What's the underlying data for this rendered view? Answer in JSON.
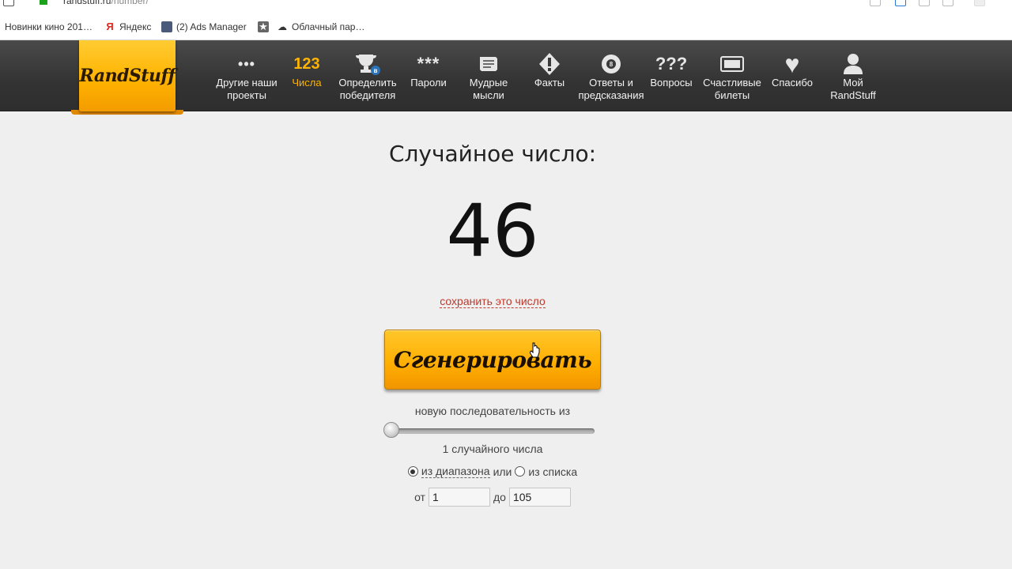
{
  "browser": {
    "url_host": "randstuff.ru",
    "url_path": "/number/",
    "bookmarks": [
      {
        "label": "Новинки кино 201…",
        "icon": "text-only"
      },
      {
        "label": "Яндекс",
        "icon": "yandex-icon"
      },
      {
        "label": "(2) Ads Manager",
        "icon": "ads-manager-icon"
      },
      {
        "label": "",
        "icon": "star-icon"
      },
      {
        "label": "Облачный пар…",
        "icon": "cloud-icon"
      }
    ]
  },
  "site": {
    "logo": "RandStuff",
    "nav": [
      {
        "icon": "dots-icon",
        "glyph": "•••",
        "label": "Другие наши проекты"
      },
      {
        "icon": "numbers-icon",
        "glyph": "123",
        "label": "Числа",
        "active": true
      },
      {
        "icon": "trophy-icon",
        "glyph": "🏆",
        "label": "Определить победителя"
      },
      {
        "icon": "password-icon",
        "glyph": "***",
        "label": "Пароли"
      },
      {
        "icon": "scroll-icon",
        "glyph": "📜",
        "label": "Мудрые мысли"
      },
      {
        "icon": "exclamation-icon",
        "glyph": "!",
        "label": "Факты"
      },
      {
        "icon": "eight-ball-icon",
        "glyph": "8",
        "label": "Ответы и предсказания"
      },
      {
        "icon": "questions-icon",
        "glyph": "???",
        "label": "Вопросы"
      },
      {
        "icon": "ticket-icon",
        "glyph": "▭",
        "label": "Счастливые билеты"
      },
      {
        "icon": "heart-icon",
        "glyph": "♥",
        "label": "Спасибо"
      },
      {
        "icon": "user-icon",
        "glyph": "👤",
        "label": "Мой RandStuff"
      }
    ]
  },
  "main": {
    "heading": "Случайное число:",
    "number": "46",
    "save_link": "сохранить это число",
    "generate_button": "Сгенерировать",
    "sequence_label": "новую последовательность из",
    "slider_value": 1,
    "count_label": "1 случайного числа",
    "range_option": "из диапазона",
    "or_text": "или",
    "list_option": "из списка",
    "from_label": "от",
    "from_value": "1",
    "to_label": "до",
    "to_value": "105"
  },
  "colors": {
    "accent": "#ffb400",
    "nav_bg": "#3a3a3a",
    "link": "#c0392b"
  }
}
